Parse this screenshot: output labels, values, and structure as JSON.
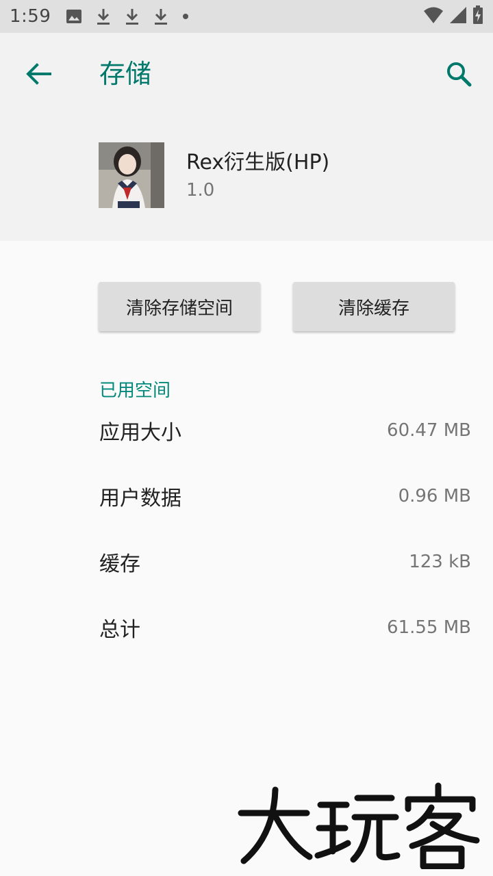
{
  "status_bar": {
    "time": "1:59",
    "left_icons": [
      "image-icon",
      "download-icon",
      "download-icon",
      "download-icon",
      "dot-icon"
    ],
    "right_icons": [
      "wifi-icon",
      "cell-signal-icon",
      "battery-charging-icon"
    ]
  },
  "toolbar": {
    "title": "存储",
    "back_icon": "arrow-back-icon",
    "search_icon": "search-icon"
  },
  "app": {
    "name": "Rex衍生版(HP)",
    "version": "1.0"
  },
  "actions": {
    "clear_storage": "清除存储空间",
    "clear_cache": "清除缓存"
  },
  "storage": {
    "section_title": "已用空间",
    "rows": [
      {
        "label": "应用大小",
        "value": "60.47 MB"
      },
      {
        "label": "用户数据",
        "value": "0.96 MB"
      },
      {
        "label": "缓存",
        "value": "123 kB"
      },
      {
        "label": "总计",
        "value": "61.55 MB"
      }
    ]
  },
  "watermark": "大玩客",
  "colors": {
    "accent": "#00796b",
    "section_accent": "#00897b",
    "status_bar_bg": "#e0e0e0",
    "header_bg": "#f2f2f2",
    "page_bg": "#fafafa",
    "button_bg": "#dddddd"
  }
}
